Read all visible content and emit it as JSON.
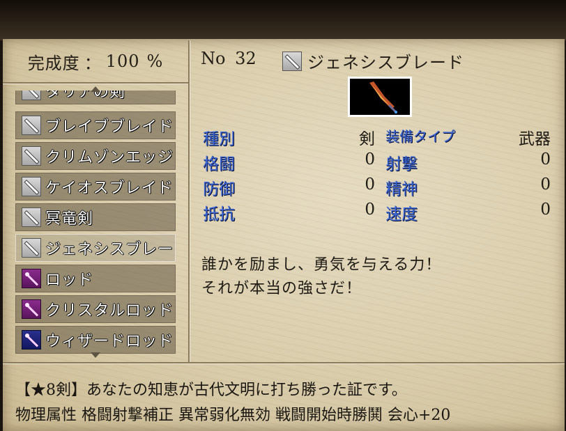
{
  "header": {
    "completion_label": "完成度",
    "completion_sep": "：",
    "completion_value": "100",
    "completion_unit": "%"
  },
  "list": {
    "items": [
      {
        "label": "タリアの剣",
        "icon": "sword-icon",
        "partial": true
      },
      {
        "label": "ブレイブブレイド",
        "icon": "sword-icon"
      },
      {
        "label": "クリムゾンエッジ",
        "icon": "sword-icon"
      },
      {
        "label": "ケイオスブレイド",
        "icon": "sword-icon"
      },
      {
        "label": "冥竜剣",
        "icon": "sword-icon"
      },
      {
        "label": "ジェネシスブレード",
        "icon": "sword-icon",
        "selected": true
      },
      {
        "label": "ロッド",
        "icon": "rod-icon-purple"
      },
      {
        "label": "クリスタルロッド",
        "icon": "rod-icon-purple"
      },
      {
        "label": "ウィザードロッド",
        "icon": "rod-icon-blue"
      }
    ]
  },
  "detail": {
    "no_label": "No",
    "no_value": "32",
    "name": "ジェネシスブレード",
    "icon": "sword-icon",
    "portrait": "blade-portrait",
    "stats": {
      "type_key": "種別",
      "type_val": "剣",
      "equip_key": "装備タイプ",
      "equip_val": "武器",
      "melee_key": "格闘",
      "melee_val": "0",
      "shoot_key": "射撃",
      "shoot_val": "0",
      "defense_key": "防御",
      "defense_val": "0",
      "spirit_key": "精神",
      "spirit_val": "0",
      "resist_key": "抵抗",
      "resist_val": "0",
      "speed_key": "速度",
      "speed_val": "0"
    },
    "description": [
      "誰かを励まし、勇気を与える力！",
      "それが本当の強さだ！"
    ]
  },
  "footer": {
    "line1": "【★8剣】あなたの知恵が古代文明に打ち勝った証です。",
    "line2": "物理属性 格闘射撃補正 異常弱化無効 戦闘開始時勝鬨 会心+20"
  },
  "colors": {
    "stat_key": "#3a66d6",
    "list_text": "#ffffff",
    "parchment": "#d8cba9"
  }
}
